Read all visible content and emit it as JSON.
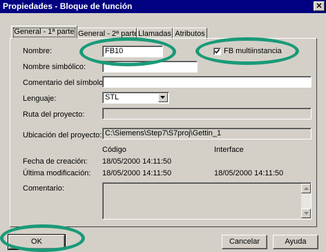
{
  "window": {
    "title": "Propiedades - Bloque de función",
    "close_glyph": "✕"
  },
  "tabs": [
    {
      "label": "General - 1ª parte"
    },
    {
      "label": "General - 2ª parte"
    },
    {
      "label": "Llamadas"
    },
    {
      "label": "Atributos"
    }
  ],
  "form": {
    "nombre_label": "Nombre:",
    "nombre_value": "FB10",
    "multiinstancia_label": "FB multiinstancia",
    "multiinstancia_checked": true,
    "nombre_simbolico_label": "Nombre simbólico:",
    "nombre_simbolico_value": "",
    "comentario_simbolo_label": "Comentario del símbolo:",
    "comentario_simbolo_value": "",
    "lenguaje_label": "Lenguaje:",
    "lenguaje_value": "STL",
    "ruta_label": "Ruta del proyecto:",
    "ruta_value": "",
    "ubicacion_label": "Ubicación del proyecto:",
    "ubicacion_value": "C:\\Siemens\\Step7\\S7proj\\Gettin_1",
    "codigo_header": "Código",
    "interface_header": "Interface",
    "fecha_creacion_label": "Fecha de creación:",
    "fecha_creacion_codigo": "18/05/2000  14:11:50",
    "ultima_mod_label": "Última modificación:",
    "ultima_mod_codigo": "18/05/2000  14:11:50",
    "ultima_mod_interface": "18/05/2000  14:11:50",
    "comentario_label": "Comentario:",
    "comentario_value": ""
  },
  "buttons": {
    "ok": "OK",
    "cancel": "Cancelar",
    "help": "Ayuda"
  },
  "colors": {
    "titlebar": "#000080",
    "dialog_bg": "#d4d0c8",
    "highlight_ellipse": "#1a9a78"
  }
}
